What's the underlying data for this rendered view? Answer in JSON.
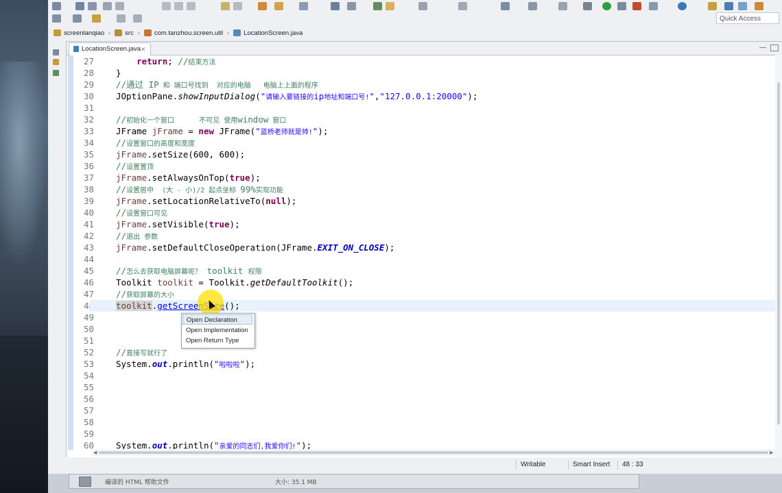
{
  "window": {
    "quick_access": "Quick Access"
  },
  "breadcrumb": [
    {
      "label": "screenlanqiao",
      "icon": "project-folder-icon"
    },
    {
      "label": "src",
      "icon": "source-folder-icon"
    },
    {
      "label": "com.tanzhou.screen.util",
      "icon": "package-icon"
    },
    {
      "label": "LocationScreen.java",
      "icon": "java-file-icon"
    }
  ],
  "editor": {
    "tab_label": "LocationScreen.java",
    "tab_close": "✕",
    "current_line": 48
  },
  "code_lines": [
    {
      "n": "27"
    },
    {
      "n": "28"
    },
    {
      "n": "29"
    },
    {
      "n": "30"
    },
    {
      "n": "31"
    },
    {
      "n": "32"
    },
    {
      "n": "33"
    },
    {
      "n": "34"
    },
    {
      "n": "35"
    },
    {
      "n": "36"
    },
    {
      "n": "37"
    },
    {
      "n": "38"
    },
    {
      "n": "39"
    },
    {
      "n": "40"
    },
    {
      "n": "41"
    },
    {
      "n": "42"
    },
    {
      "n": "43"
    },
    {
      "n": "44"
    },
    {
      "n": "45"
    },
    {
      "n": "46"
    },
    {
      "n": "47"
    },
    {
      "n": "48"
    },
    {
      "n": "49"
    },
    {
      "n": "50"
    },
    {
      "n": "51"
    },
    {
      "n": "52"
    },
    {
      "n": "53"
    },
    {
      "n": "54"
    },
    {
      "n": "55"
    },
    {
      "n": "56"
    },
    {
      "n": "57"
    },
    {
      "n": "58"
    },
    {
      "n": "59"
    },
    {
      "n": "60"
    }
  ],
  "code": {
    "l27_kw": "return",
    "l27_rest": "; ",
    "l27_cm": "//",
    "l27_cmcn": "结束方法",
    "l28": "}",
    "l29_a": "//通过 ",
    "l29_b": "IP",
    "l29_c": " 和 端口号找到  对应的电脑   电脑上上面的程序",
    "l30_a": "JOptionPane.",
    "l30_m": "showInputDialog",
    "l30_b": "(",
    "l30_s1": "\"",
    "l30_s1cn": "请输入要链接的",
    "l30_s1b": "ip",
    "l30_s1cn2": "地址和端口号!",
    "l30_s1c": "\"",
    "l30_c": ",",
    "l30_s2": "\"127.0.0.1:20000\"",
    "l30_d": ");",
    "l32_a": "//",
    "l32_cn": "初始化一个窗口      不可见 使用",
    "l32_b": "window",
    "l32_cn2": " 窗口",
    "l33_a": "JFrame ",
    "l33_v": "jFrame",
    "l33_b": " = ",
    "l33_kw": "new",
    "l33_c": " JFrame(",
    "l33_s": "\"",
    "l33_scn": "蓝桥老师就是帅!",
    "l33_s2": "\"",
    "l33_d": ");",
    "l34_a": "//",
    "l34_cn": "设置窗口的高度和宽度",
    "l35_v": "jFrame",
    "l35_r": ".setSize(600, 600);",
    "l36_a": "//",
    "l36_cn": "设置置顶",
    "l37_v": "jFrame",
    "l37_r": ".setAlwaysOnTop(",
    "l37_kw": "true",
    "l37_e": ");",
    "l38_a": "//",
    "l38_cn": "设置居中  (大 - 小)/2 起点坐标 ",
    "l38_b": "99%",
    "l38_cn2": "实现功能",
    "l39_v": "jFrame",
    "l39_r": ".setLocationRelativeTo(",
    "l39_kw": "null",
    "l39_e": ");",
    "l40_a": "//",
    "l40_cn": "设置窗口可见",
    "l41_v": "jFrame",
    "l41_r": ".setVisible(",
    "l41_kw": "true",
    "l41_e": ");",
    "l42_a": "//",
    "l42_cn": "退出 参数",
    "l43_v": "jFrame",
    "l43_r": ".setDefaultCloseOperation(JFrame.",
    "l43_f": "EXIT_ON_CLOSE",
    "l43_e": ");",
    "l45_a": "//",
    "l45_cn": "怎么去获取电脑屏幕呢？",
    "l45_b": " toolkit ",
    "l45_cn2": "权限",
    "l46_a": "Toolkit ",
    "l46_v": "toolkit",
    "l46_b": " = Toolkit.",
    "l46_m": "getDefaultToolkit",
    "l46_e": "();",
    "l47_a": "//",
    "l47_cn": "获取屏幕的大小",
    "l48_v": "toolkit",
    "l48_dot": ".",
    "l48_m": "getScreenSize",
    "l48_e": "();",
    "l52_a": "//",
    "l52_cn": "直接写就行了",
    "l53_a": "System.",
    "l53_f": "out",
    "l53_b": ".println(",
    "l53_s": "\"",
    "l53_scn": "啦啦啦",
    "l53_s2": "\"",
    "l53_e": ");",
    "l60_a": "System.",
    "l60_f": "out",
    "l60_b": ".println(",
    "l60_s": "\"",
    "l60_scn": "亲爱的同志们,我爱你们!",
    "l60_s2": "\"",
    "l60_e": ");"
  },
  "popup": {
    "items": [
      "Open Declaration",
      "Open Implementation",
      "Open Return Type"
    ]
  },
  "status": {
    "writable": "Writable",
    "insert_mode": "Smart Insert",
    "position": "48 : 33"
  },
  "taskbar": {
    "item_label": "编译的 HTML 帮助文件",
    "item_size": "大小: 35.1 MB"
  },
  "colors": {
    "keyword": "#7f0055",
    "comment": "#3f7f5f",
    "string": "#2a00ff",
    "field": "#0000c0",
    "current_line": "#e8f2fe"
  }
}
